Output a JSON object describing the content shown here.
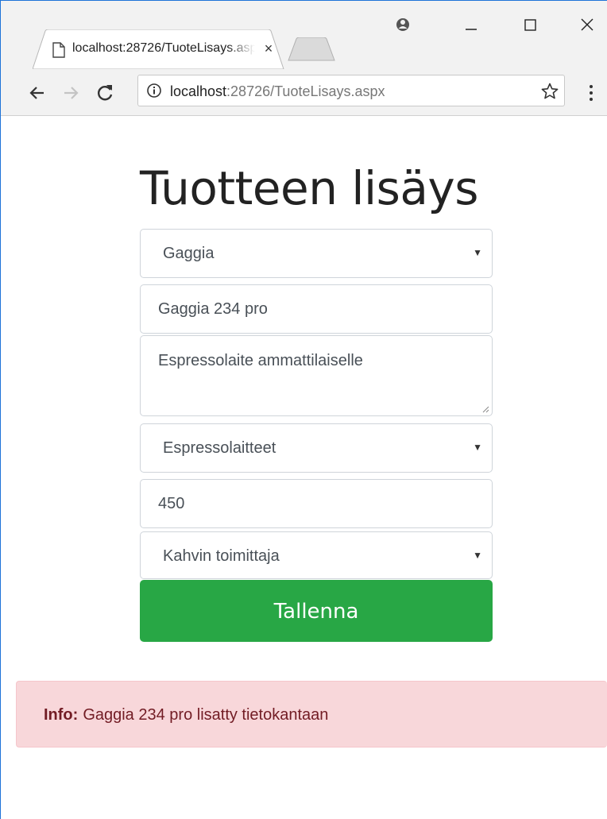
{
  "browser": {
    "tab": {
      "title": "localhost:28726/TuoteLisays.aspx",
      "close_glyph": "×"
    },
    "controls": {
      "minimize_glyph": "–",
      "maximize_glyph": "☐",
      "close_glyph": "✕"
    },
    "address": {
      "host": "localhost",
      "rest": ":28726/TuoteLisays.aspx"
    },
    "icons": [
      "page-icon",
      "profile-icon",
      "back-arrow-icon",
      "forward-arrow-icon",
      "reload-icon",
      "info-icon",
      "star-icon",
      "kebab-menu-icon"
    ]
  },
  "page": {
    "title": "Tuotteen lisäys",
    "form": {
      "brand_select": "Gaggia",
      "name_input": "Gaggia 234 pro",
      "description_textarea": "Espressolaite ammattilaiselle",
      "category_select": "Espressolaitteet",
      "price_input": "450",
      "supplier_select": "Kahvin toimittaja",
      "save_label": "Tallenna",
      "caret": "▼"
    },
    "alert": {
      "label": "Info:",
      "message": "Gaggia 234 pro lisatty tietokantaan"
    }
  },
  "colors": {
    "primary_button": "#28a745",
    "alert_background": "#f8d7da",
    "alert_text": "#721c24",
    "window_border": "#1e73d8"
  }
}
